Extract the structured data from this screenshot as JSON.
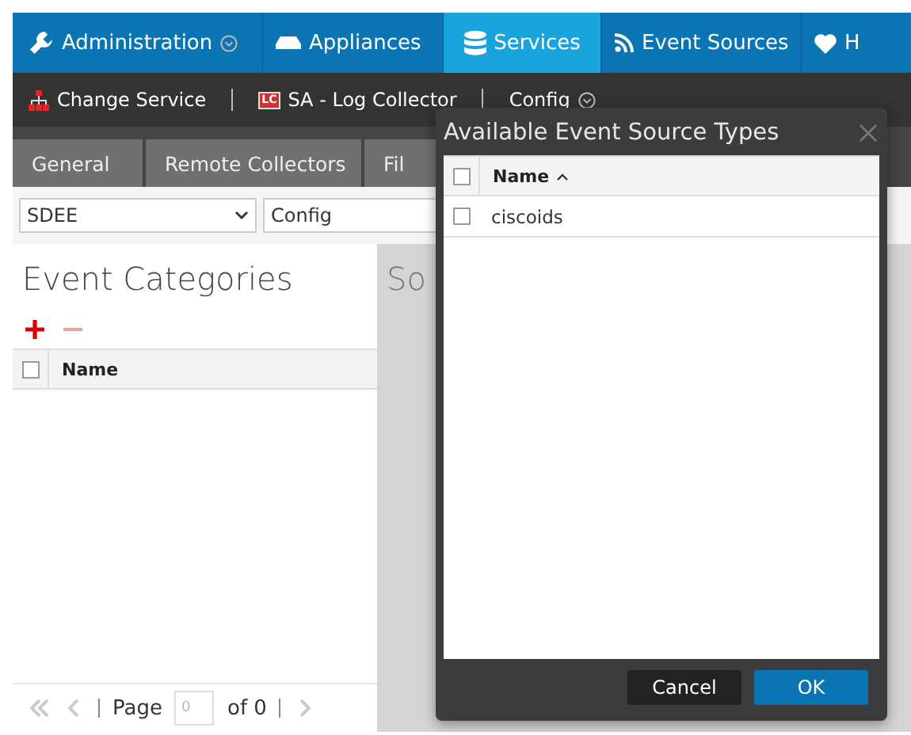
{
  "nav": [
    {
      "label": "Administration",
      "dropdown": true,
      "selected": false
    },
    {
      "label": "Appliances",
      "dropdown": false,
      "selected": false
    },
    {
      "label": "Services",
      "dropdown": false,
      "selected": true
    },
    {
      "label": "Event Sources",
      "dropdown": false,
      "selected": false
    },
    {
      "label": "H",
      "dropdown": false,
      "selected": false
    }
  ],
  "service_bar": {
    "change_service": "Change Service",
    "service_badge": "LC",
    "service_name": "SA - Log Collector",
    "view": "Config"
  },
  "tabs": [
    {
      "label": "General",
      "selected": false
    },
    {
      "label": "Remote Collectors",
      "selected": false
    },
    {
      "label": "Fil",
      "selected": false
    }
  ],
  "filters": {
    "type": "SDEE",
    "mode": "Config"
  },
  "categories_panel": {
    "title": "Event Categories",
    "all_checked": false,
    "columns": [
      "Name"
    ],
    "pager": {
      "page_label": "Page",
      "page": "0",
      "of": "of 0"
    }
  },
  "sources_panel": {
    "title": "So"
  },
  "dialog": {
    "title": "Available Event Source Types",
    "all_checked": false,
    "columns": [
      {
        "label": "Name",
        "sorted": true
      }
    ],
    "rows": [
      {
        "name": "ciscoids",
        "checked": false
      }
    ],
    "buttons": [
      {
        "label": "Cancel",
        "kind": "secondary"
      },
      {
        "label": "OK",
        "kind": "primary"
      }
    ]
  }
}
